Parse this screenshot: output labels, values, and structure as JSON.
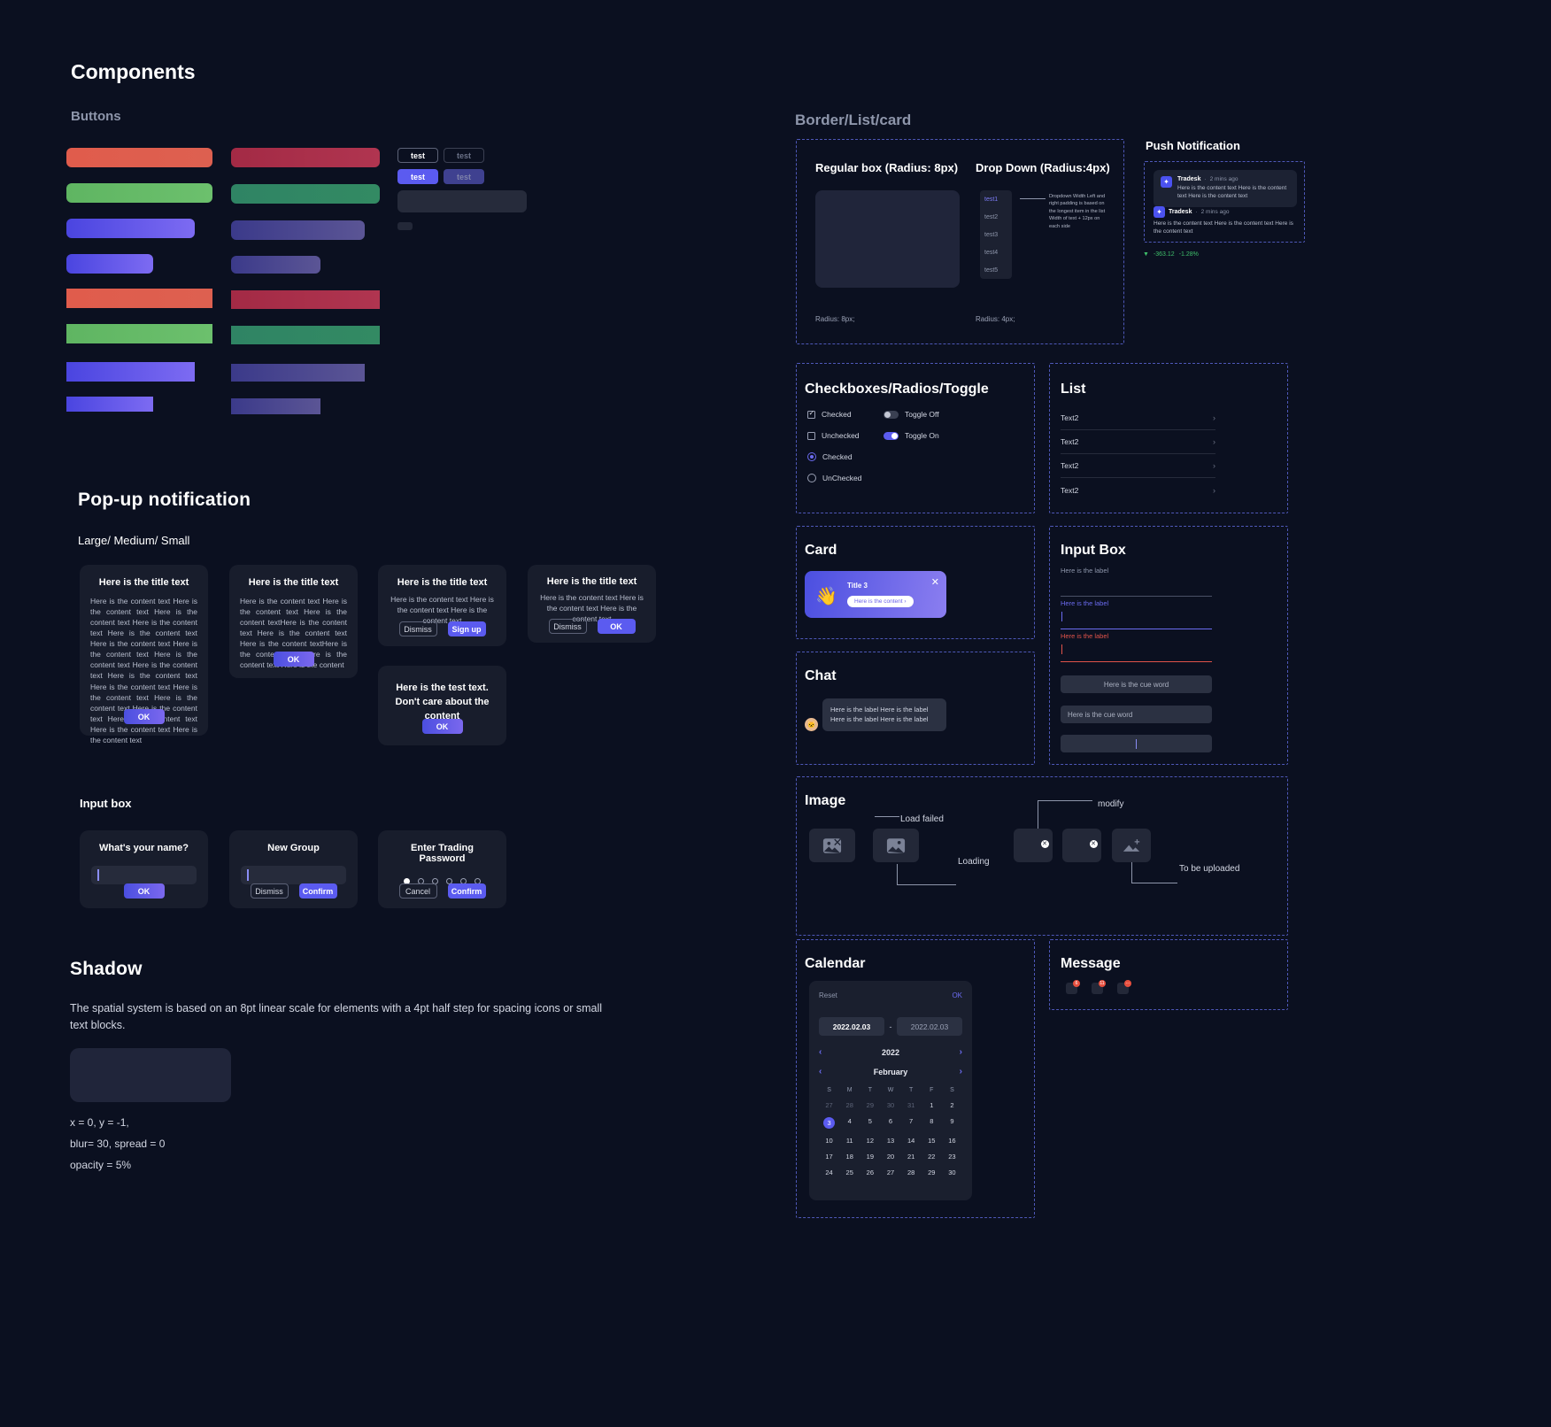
{
  "left": {
    "components_title": "Components",
    "buttons_label": "Buttons",
    "tiny_buttons": [
      {
        "label": "test",
        "style": "outline"
      },
      {
        "label": "test",
        "style": "outline-dim"
      },
      {
        "label": "test",
        "style": "solid"
      },
      {
        "label": "test",
        "style": "solid-dim"
      }
    ],
    "popup": {
      "section_title": "Pop-up notification",
      "size_label": "Large/ Medium/ Small",
      "title_text": "Here is the title text",
      "large_body": "Here is the content text Here is the content text Here is the content text Here is the content text Here is the content text Here is the content text Here is the content text Here is the content text Here is the content text Here is the content text Here is the content text Here is the content text Here is the content text Here is the content text Here is the content text Here is the content text Here is the content text",
      "medium_body": "Here is the content text Here is the content text Here is the content textHere is the content text Here is the content text Here is the content textHere is the content text Here is the content text Here is the content",
      "small_body": "Here is the content text Here is the content text Here is the content text",
      "test_text": "Here is the test text. Don't care about the content",
      "ok": "OK",
      "dismiss": "Dismiss",
      "signup": "Sign up"
    },
    "inputbox": {
      "section_title": "Input box",
      "d1_title": "What's your name?",
      "d1_ok": "OK",
      "d2_title": "New Group",
      "d2_dismiss": "Dismiss",
      "d2_confirm": "Confirm",
      "d3_title": "Enter Trading Password",
      "d3_cancel": "Cancel",
      "d3_confirm": "Confirm",
      "pin_count": 6
    },
    "shadow": {
      "title": "Shadow",
      "description": "The spatial system is based on an 8pt linear scale for elements with a 4pt half step for spacing icons or small text blocks.",
      "line1": "x = 0, y = -1,",
      "line2": "blur= 30, spread = 0",
      "line3": "opacity = 5%"
    }
  },
  "right": {
    "section_title": "Border/List/card",
    "box_panel": {
      "regular_title": "Regular box (Radius: 8px)",
      "dropdown_title": "Drop Down (Radius:4px)",
      "regular_caption": "Radius: 8px;",
      "dropdown_caption": "Radius: 4px;",
      "dropdown_items": [
        "test1",
        "test2",
        "test3",
        "test4",
        "test5"
      ],
      "dropdown_note": "Dropdown Width Left and right padding is based on the longest item in the list Width of text + 12px on each side"
    },
    "push": {
      "title": "Push Notification",
      "items": [
        {
          "app": "Tradesk",
          "time": "2 mins ago",
          "text": "Here is the content text Here is the content text Here is the content text"
        },
        {
          "app": "Tradesk",
          "time": "2 mins ago",
          "text": "Here is the content text Here is the content text Here is the content text"
        }
      ],
      "ticker_value": "-363.12",
      "ticker_percent": "-1.28%"
    },
    "controls": {
      "title": "Checkboxes/Radios/Toggle",
      "checkbox_checked": "Checked",
      "checkbox_unchecked": "Unchecked",
      "radio_checked": "Checked",
      "radio_unchecked": "UnChecked",
      "toggle_off": "Toggle Off",
      "toggle_on": "Toggle On"
    },
    "list": {
      "title": "List",
      "items": [
        "Text2",
        "Text2",
        "Text2",
        "Text2"
      ]
    },
    "card": {
      "title": "Card",
      "card_title": "Title 3",
      "card_pill": "Here is the content ›",
      "close": "✕"
    },
    "chat": {
      "title": "Chat",
      "message": "Here is the label Here is the label Here is the label Here is the label"
    },
    "input_box": {
      "title": "Input Box",
      "label_default": "Here is the label",
      "label_active": "Here is the label",
      "label_error": "Here is the label",
      "cue1": "Here is the cue word",
      "cue2": "Here is the cue word"
    },
    "image": {
      "title": "Image",
      "load_failed": "Load failed",
      "loading": "Loading",
      "modify": "modify",
      "to_be_uploaded": "To be uploaded"
    },
    "calendar": {
      "title": "Calendar",
      "reset": "Reset",
      "ok": "OK",
      "start_date": "2022.02.03",
      "separator": "-",
      "end_date": "2022.02.03",
      "year": "2022",
      "month": "February",
      "weekdays": [
        "S",
        "M",
        "T",
        "W",
        "T",
        "F",
        "S"
      ],
      "weeks": [
        [
          {
            "d": "27",
            "mut": true
          },
          {
            "d": "28",
            "mut": true
          },
          {
            "d": "29",
            "mut": true
          },
          {
            "d": "30",
            "mut": true
          },
          {
            "d": "31",
            "mut": true
          },
          {
            "d": "1"
          },
          {
            "d": "2"
          }
        ],
        [
          {
            "d": "3",
            "sel": true
          },
          {
            "d": "4"
          },
          {
            "d": "5"
          },
          {
            "d": "6"
          },
          {
            "d": "7"
          },
          {
            "d": "8"
          },
          {
            "d": "9"
          }
        ],
        [
          {
            "d": "10"
          },
          {
            "d": "11"
          },
          {
            "d": "12"
          },
          {
            "d": "13"
          },
          {
            "d": "14"
          },
          {
            "d": "15"
          },
          {
            "d": "16"
          }
        ],
        [
          {
            "d": "17"
          },
          {
            "d": "18"
          },
          {
            "d": "19"
          },
          {
            "d": "20"
          },
          {
            "d": "21"
          },
          {
            "d": "22"
          },
          {
            "d": "23"
          }
        ],
        [
          {
            "d": "24"
          },
          {
            "d": "25"
          },
          {
            "d": "26"
          },
          {
            "d": "27"
          },
          {
            "d": "28"
          },
          {
            "d": "29"
          },
          {
            "d": "30"
          }
        ]
      ]
    },
    "message": {
      "title": "Message",
      "badges": [
        "6",
        "11",
        "···"
      ]
    }
  }
}
